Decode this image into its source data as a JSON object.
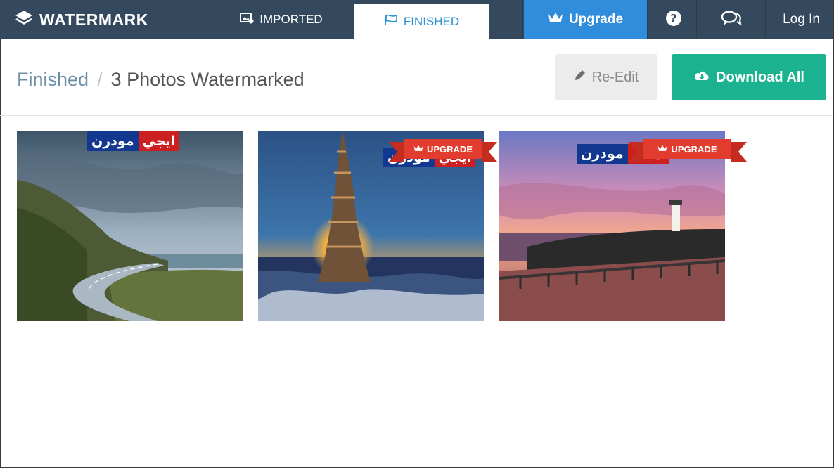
{
  "nav": {
    "brand": "WATERMARK",
    "tabs": [
      {
        "label": "IMPORTED",
        "icon": "images-icon"
      },
      {
        "label": "FINISHED",
        "icon": "flag-icon"
      }
    ],
    "upgrade_label": "Upgrade",
    "login_label": "Log In"
  },
  "header": {
    "breadcrumb_root": "Finished",
    "breadcrumb_separator": "/",
    "breadcrumb_current": "3 Photos Watermarked",
    "reedit_label": "Re-Edit",
    "download_label": "Download All"
  },
  "photos": [
    {
      "watermark_red": "ايجي",
      "watermark_blue": "مودرن",
      "ribbon": ""
    },
    {
      "watermark_red": "ايجي",
      "watermark_blue": "مودرن",
      "ribbon": "UPGRADE"
    },
    {
      "watermark_red": "ايجي",
      "watermark_blue": "مودرن",
      "ribbon": "UPGRADE"
    }
  ],
  "colors": {
    "nav_bg": "#34495e",
    "accent_blue": "#2f8ddb",
    "download_green": "#1bb38f",
    "ribbon_red": "#e23c2e"
  }
}
